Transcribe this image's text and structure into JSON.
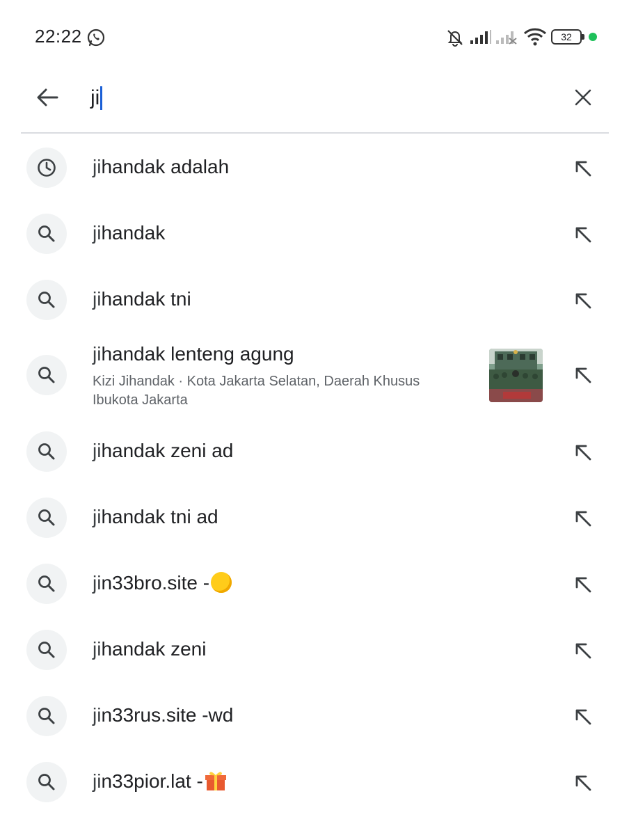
{
  "status_bar": {
    "time": "22:22",
    "battery": "32",
    "icons": [
      "whatsapp-icon",
      "bell-off-icon",
      "signal-icon",
      "signal-no-service-icon",
      "wifi-icon",
      "battery-icon"
    ]
  },
  "search": {
    "query": "ji",
    "back_icon": "arrow-left-icon",
    "clear_icon": "close-icon"
  },
  "suggestions": [
    {
      "icon": "history-icon",
      "typed": "ji",
      "rest": "handak adalah"
    },
    {
      "icon": "search-icon",
      "typed": "ji",
      "rest": "handak"
    },
    {
      "icon": "search-icon",
      "typed": "ji",
      "rest": "handak tni"
    },
    {
      "icon": "search-icon",
      "typed": "ji",
      "rest": "handak lenteng agung",
      "sub": "Kizi Jihandak · Kota Jakarta Selatan, Daerah Khusus Ibukota Jakarta",
      "thumbnail": true
    },
    {
      "icon": "search-icon",
      "typed": "ji",
      "rest": "handak zeni ad"
    },
    {
      "icon": "search-icon",
      "typed": "ji",
      "rest": "handak tni ad"
    },
    {
      "icon": "search-icon",
      "typed": "ji",
      "rest": "n33bro.site -",
      "emoji": "yellow-circle"
    },
    {
      "icon": "search-icon",
      "typed": "ji",
      "rest": "handak zeni"
    },
    {
      "icon": "search-icon",
      "typed": "ji",
      "rest": "n33rus.site -wd"
    },
    {
      "icon": "search-icon",
      "typed": "ji",
      "rest": "n33pior.lat -",
      "emoji": "gift"
    }
  ],
  "colors": {
    "caret": "#1a5fd6",
    "icon_bg": "#f1f3f4",
    "text": "#202124",
    "subtext": "#5f6368"
  }
}
